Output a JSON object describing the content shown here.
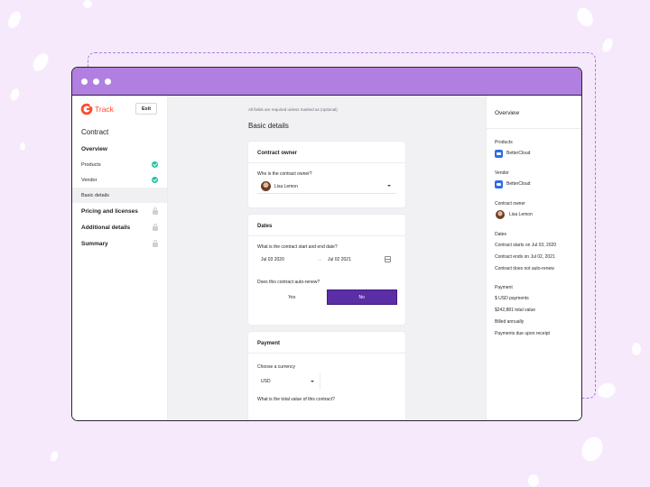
{
  "app": {
    "brand_name": "Track",
    "exit_label": "Exit",
    "accent": "#5b2ea6",
    "titlebar_color": "#b07fe0"
  },
  "sidebar": {
    "title": "Contract",
    "overview_label": "Overview",
    "subitems": [
      {
        "label": "Products",
        "status": "complete"
      },
      {
        "label": "Vendor",
        "status": "complete"
      },
      {
        "label": "Basic details",
        "status": "active"
      }
    ],
    "sections": [
      {
        "label": "Pricing and licenses",
        "status": "locked"
      },
      {
        "label": "Additional details",
        "status": "locked"
      },
      {
        "label": "Summary",
        "status": "locked"
      }
    ]
  },
  "main": {
    "hint": "All fields are required unless marked as (optional)",
    "section_title": "Basic details",
    "owner_card": {
      "title": "Contract owner",
      "question": "Who is the contract owner?",
      "selected_owner": "Lisa Lemon"
    },
    "dates_card": {
      "title": "Dates",
      "question": "What is the contract start and end date?",
      "start_date": "Jul 03 2020",
      "end_date": "Jul 02 2021",
      "autorenew_question": "Does this contract auto-renew?",
      "yes_label": "Yes",
      "no_label": "No",
      "selected": "No"
    },
    "payment_card": {
      "title": "Payment",
      "currency_question": "Choose a currency",
      "currency_value": "USD",
      "total_question": "What is the total value of this contract?"
    }
  },
  "overview": {
    "title": "Overview",
    "products_label": "Products",
    "product_name": "BetterCloud",
    "vendor_label": "Vendor",
    "vendor_name": "BetterCloud",
    "owner_label": "Contract owner",
    "owner_name": "Lisa Lemon",
    "dates_label": "Dates",
    "dates": [
      "Contract starts on Jul 03, 2020",
      "Contract ends on Jul 02, 2021",
      "Contract does not auto-renew"
    ],
    "payment_label": "Payment",
    "payment": [
      "$ USD payments",
      "$242,881 total value",
      "Billed annually",
      "Payments due upon receipt"
    ]
  }
}
